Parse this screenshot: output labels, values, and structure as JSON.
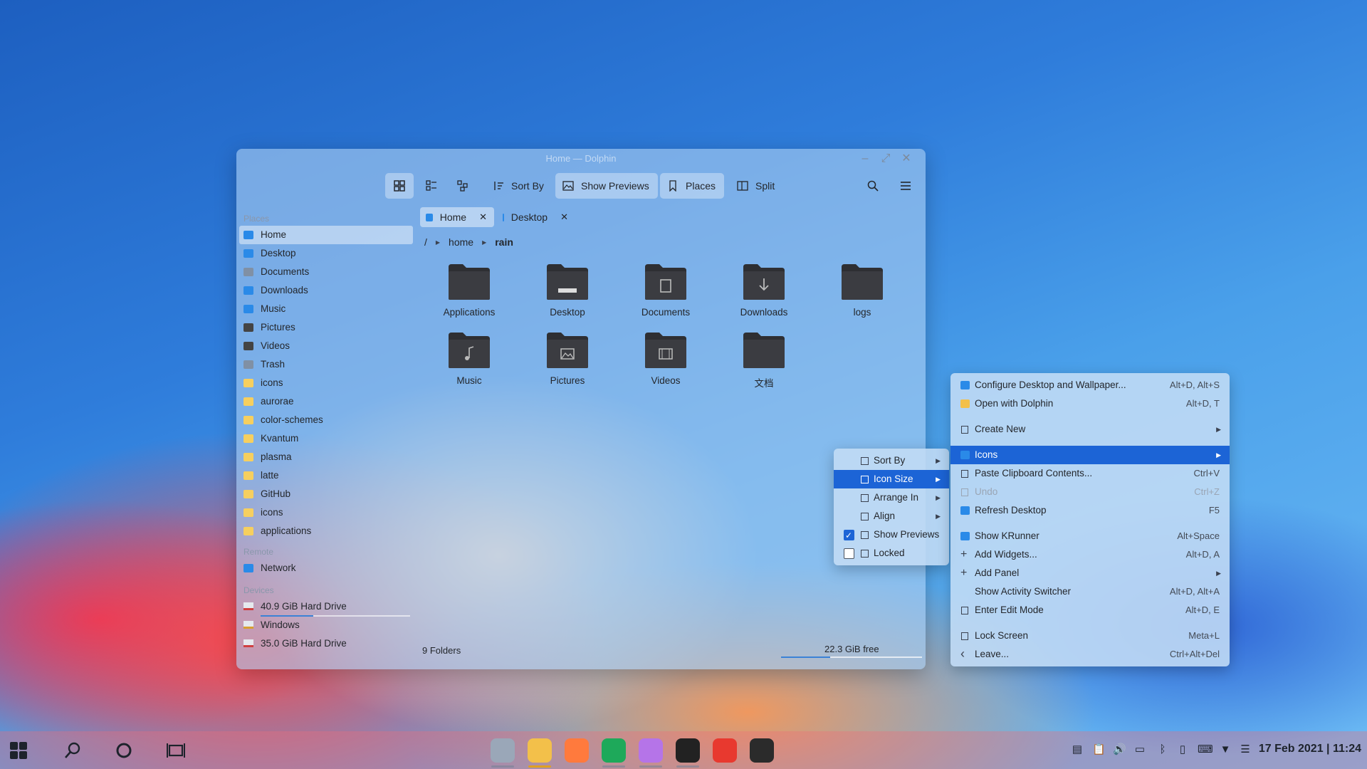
{
  "window": {
    "title": "Home — Dolphin"
  },
  "toolbar": {
    "sort_by": "Sort By",
    "show_previews": "Show Previews",
    "places": "Places",
    "split": "Split"
  },
  "sidebar": {
    "places_header": "Places",
    "places": [
      {
        "label": "Home",
        "icon": "home-icon",
        "color": "#2a8ae8"
      },
      {
        "label": "Desktop",
        "icon": "desktop-icon",
        "color": "#2a8ae8"
      },
      {
        "label": "Documents",
        "icon": "documents-icon",
        "color": "#8090a5"
      },
      {
        "label": "Downloads",
        "icon": "downloads-icon",
        "color": "#2a8ae8"
      },
      {
        "label": "Music",
        "icon": "music-icon",
        "color": "#2a8ae8"
      },
      {
        "label": "Pictures",
        "icon": "pictures-icon",
        "color": "#444"
      },
      {
        "label": "Videos",
        "icon": "videos-icon",
        "color": "#444"
      },
      {
        "label": "Trash",
        "icon": "trash-icon",
        "color": "#8090a5"
      },
      {
        "label": "icons",
        "icon": "folder-icon",
        "color": "#f6cf5f"
      },
      {
        "label": "aurorae",
        "icon": "folder-icon",
        "color": "#f6cf5f"
      },
      {
        "label": "color-schemes",
        "icon": "folder-icon",
        "color": "#f6cf5f"
      },
      {
        "label": "Kvantum",
        "icon": "folder-icon",
        "color": "#f6cf5f"
      },
      {
        "label": "plasma",
        "icon": "folder-icon",
        "color": "#f6cf5f"
      },
      {
        "label": "latte",
        "icon": "folder-icon",
        "color": "#f6cf5f"
      },
      {
        "label": "GitHub",
        "icon": "folder-icon",
        "color": "#f6cf5f"
      },
      {
        "label": "icons",
        "icon": "folder-icon",
        "color": "#f6cf5f"
      },
      {
        "label": "applications",
        "icon": "folder-icon",
        "color": "#f6cf5f"
      }
    ],
    "remote_header": "Remote",
    "remote": [
      {
        "label": "Network",
        "icon": "network-icon"
      }
    ],
    "devices_header": "Devices",
    "devices": [
      {
        "label": "40.9 GiB Hard Drive",
        "icon": "hard-drive-icon",
        "usage": 0.35
      },
      {
        "label": "Windows",
        "icon": "hard-drive-icon"
      },
      {
        "label": "35.0 GiB Hard Drive",
        "icon": "hard-drive-icon"
      }
    ]
  },
  "tabs": [
    {
      "label": "Home",
      "active": true
    },
    {
      "label": "Desktop",
      "active": false
    }
  ],
  "breadcrumb": {
    "root": "/",
    "parts": [
      "home",
      "rain"
    ]
  },
  "folders": [
    {
      "label": "Applications",
      "emblem": "none"
    },
    {
      "label": "Desktop",
      "emblem": "desktop"
    },
    {
      "label": "Documents",
      "emblem": "document"
    },
    {
      "label": "Downloads",
      "emblem": "download"
    },
    {
      "label": "logs",
      "emblem": "none"
    },
    {
      "label": "Music",
      "emblem": "music"
    },
    {
      "label": "Pictures",
      "emblem": "picture"
    },
    {
      "label": "Videos",
      "emblem": "video"
    },
    {
      "label": "文档",
      "emblem": "none"
    }
  ],
  "status": {
    "count": "9 Folders",
    "free": "22.3 GiB free",
    "free_usage": 0.35
  },
  "submenu": {
    "items": [
      {
        "label": "Sort By",
        "icon": "sort-icon",
        "arrow": true
      },
      {
        "label": "Icon Size",
        "icon": "icon-size-icon",
        "arrow": true,
        "highlight": true
      },
      {
        "label": "Arrange In",
        "icon": "arrange-icon",
        "arrow": true
      },
      {
        "label": "Align",
        "icon": "align-icon",
        "arrow": true
      },
      {
        "label": "Show Previews",
        "icon": "preview-icon",
        "checked": true
      },
      {
        "label": "Locked",
        "icon": "lock-icon",
        "checked": false
      }
    ]
  },
  "context_menu": {
    "items": [
      {
        "label": "Configure Desktop and Wallpaper...",
        "shortcut": "Alt+D, Alt+S",
        "icon": "configure-icon"
      },
      {
        "label": "Open with Dolphin",
        "shortcut": "Alt+D, T",
        "icon": "dolphin-icon"
      },
      {
        "gap": true
      },
      {
        "label": "Create New",
        "arrow": true,
        "icon": "new-file-icon"
      },
      {
        "gap": true
      },
      {
        "label": "Icons",
        "arrow": true,
        "highlight": true,
        "icon": "icons-icon"
      },
      {
        "label": "Paste Clipboard Contents...",
        "shortcut": "Ctrl+V",
        "icon": "paste-icon"
      },
      {
        "label": "Undo",
        "shortcut": "Ctrl+Z",
        "disabled": true,
        "icon": "undo-icon"
      },
      {
        "label": "Refresh Desktop",
        "shortcut": "F5",
        "icon": "refresh-icon"
      },
      {
        "gap": true
      },
      {
        "label": "Show KRunner",
        "shortcut": "Alt+Space",
        "icon": "krunner-icon"
      },
      {
        "label": "Add Widgets...",
        "shortcut": "Alt+D, A",
        "icon": "plus-icon"
      },
      {
        "label": "Add Panel",
        "arrow": true,
        "icon": "plus-icon"
      },
      {
        "label": "Show Activity Switcher",
        "shortcut": "Alt+D, Alt+A",
        "icon": ""
      },
      {
        "label": "Enter Edit Mode",
        "shortcut": "Alt+D, E",
        "icon": "edit-icon"
      },
      {
        "gap": true
      },
      {
        "label": "Lock Screen",
        "shortcut": "Meta+L",
        "icon": "lock-icon"
      },
      {
        "label": "Leave...",
        "shortcut": "Ctrl+Alt+Del",
        "icon": "leave-icon"
      }
    ]
  },
  "taskbar": {
    "apps": [
      {
        "name": "system-settings-icon",
        "color": "#9aa7b8"
      },
      {
        "name": "dolphin-icon",
        "color": "#f3c04a"
      },
      {
        "name": "firefox-icon",
        "color": "#ff7a3d"
      },
      {
        "name": "edge-icon",
        "color": "#1ea95a"
      },
      {
        "name": "store-icon",
        "color": "#b574e8"
      },
      {
        "name": "github-icon",
        "color": "#222222"
      },
      {
        "name": "netease-music-icon",
        "color": "#e8392f"
      },
      {
        "name": "typora-icon",
        "color": "#2b2b2b"
      }
    ],
    "clock": "17 Feb 2021 | 11:24"
  }
}
